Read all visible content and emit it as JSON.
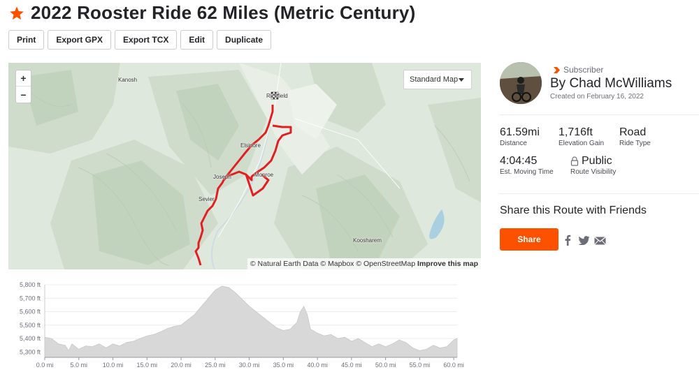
{
  "route": {
    "title": "2022 Rooster Ride 62 Miles (Metric Century)",
    "star_icon": "star-icon",
    "accent_color": "#fc5200"
  },
  "toolbar": {
    "print_label": "Print",
    "export_gpx_label": "Export GPX",
    "export_tcx_label": "Export TCX",
    "edit_label": "Edit",
    "duplicate_label": "Duplicate"
  },
  "map": {
    "zoom_in_label": "+",
    "zoom_out_label": "−",
    "map_type_selected": "Standard Map",
    "towns": {
      "kanosh": "Kanosh",
      "richfield": "Richfield",
      "elsinore": "Elsinore",
      "joseph": "Joseph",
      "monroe": "Monroe",
      "sevier": "Sevier",
      "koosharem": "Koosharem"
    },
    "attribution": "© Natural Earth Data © Mapbox © OpenStreetMap",
    "improve_link": "Improve this map",
    "route_color": "#e02020"
  },
  "author": {
    "badge": "Subscriber",
    "name": "By Chad McWilliams",
    "created": "Created on February 16, 2022"
  },
  "stats": {
    "distance": {
      "value": "61.59mi",
      "label": "Distance"
    },
    "elevation": {
      "value": "1,716ft",
      "label": "Elevation Gain"
    },
    "ride_type": {
      "value": "Road",
      "label": "Ride Type"
    },
    "moving_time": {
      "value": "4:04:45",
      "label": "Est. Moving Time"
    },
    "visibility": {
      "value": "Public",
      "label": "Route Visibility",
      "icon": "lock-icon"
    }
  },
  "share": {
    "title": "Share this Route with Friends",
    "button_label": "Share",
    "icons": [
      "facebook-icon",
      "twitter-icon",
      "email-icon"
    ]
  },
  "chart_data": {
    "type": "area",
    "xlabel": "",
    "ylabel": "",
    "xlim": [
      0,
      60.5
    ],
    "ylim": [
      5260,
      5800
    ],
    "y_ticks": [
      5300,
      5400,
      5500,
      5600,
      5700,
      5800
    ],
    "y_tick_labels": [
      "5,300 ft",
      "5,400 ft",
      "5,500 ft",
      "5,600 ft",
      "5,700 ft",
      "5,800 ft"
    ],
    "x_ticks": [
      0,
      5,
      10,
      15,
      20,
      25,
      30,
      35,
      40,
      45,
      50,
      55,
      60
    ],
    "x_tick_labels": [
      "0.0 mi",
      "5.0 mi",
      "10.0 mi",
      "15.0 mi",
      "20.0 mi",
      "25.0 mi",
      "30.0 mi",
      "35.0 mi",
      "40.0 mi",
      "45.0 mi",
      "50.0 mi",
      "55.0 mi",
      "60.0 mi"
    ],
    "grid": true,
    "fill_color": "#d8d8d8",
    "series": [
      {
        "x": [
          0,
          1,
          2,
          3,
          3.5,
          4,
          5,
          6,
          7,
          8,
          9,
          10,
          11,
          12,
          13,
          14,
          15,
          16,
          17,
          18,
          19,
          20,
          21,
          22,
          23,
          24,
          25,
          26,
          27,
          28,
          29,
          30,
          31,
          32,
          33,
          34,
          35,
          36,
          37,
          37.5,
          38,
          38.5,
          39,
          40,
          41,
          42,
          43,
          44,
          45,
          46,
          47,
          48,
          49,
          50,
          51,
          52,
          53,
          54,
          55,
          56,
          57,
          58,
          59,
          60,
          60.5
        ],
        "values": [
          5410,
          5400,
          5360,
          5350,
          5310,
          5360,
          5320,
          5345,
          5340,
          5360,
          5330,
          5360,
          5345,
          5370,
          5380,
          5400,
          5420,
          5430,
          5450,
          5475,
          5490,
          5500,
          5540,
          5580,
          5640,
          5700,
          5760,
          5790,
          5780,
          5740,
          5690,
          5640,
          5600,
          5560,
          5520,
          5480,
          5460,
          5470,
          5520,
          5600,
          5640,
          5580,
          5470,
          5440,
          5420,
          5430,
          5400,
          5410,
          5380,
          5400,
          5370,
          5340,
          5360,
          5340,
          5360,
          5390,
          5370,
          5330,
          5310,
          5320,
          5350,
          5330,
          5340,
          5390,
          5400
        ]
      }
    ]
  }
}
